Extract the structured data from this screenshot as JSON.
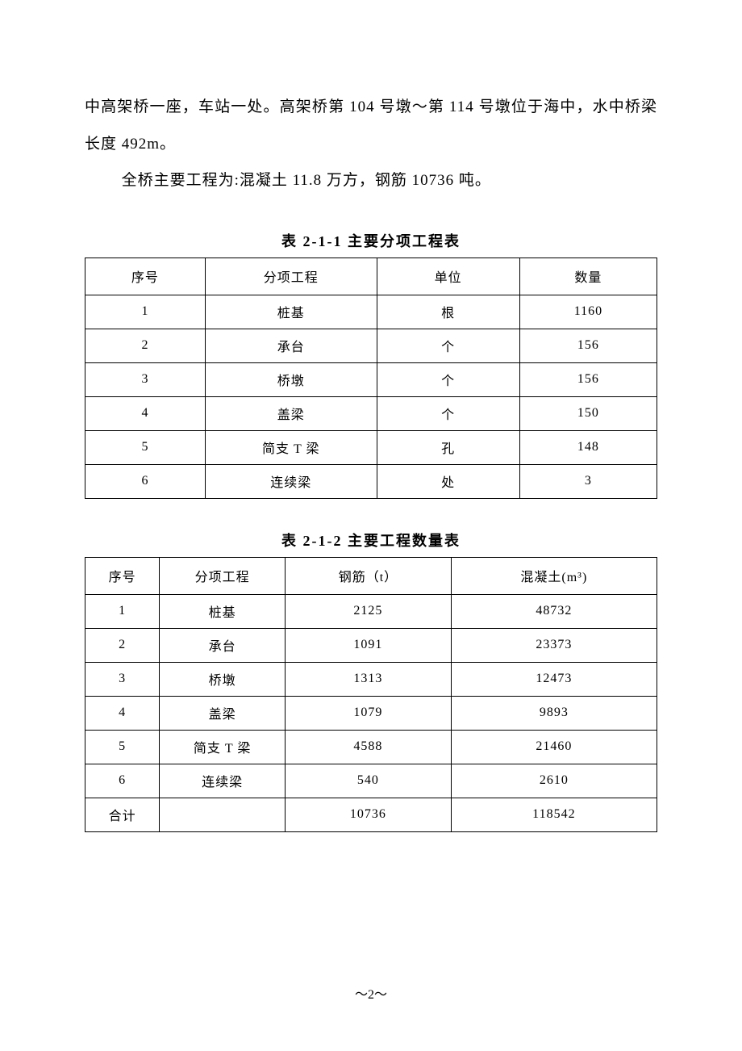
{
  "paragraphs": {
    "p1": "中高架桥一座，车站一处。高架桥第 104 号墩～第 114 号墩位于海中，水中桥梁长度 492m。",
    "p2": "全桥主要工程为:混凝土 11.8 万方，钢筋 10736 吨。"
  },
  "table1": {
    "title": "表 2-1-1   主要分项工程表",
    "headers": [
      "序号",
      "分项工程",
      "单位",
      "数量"
    ],
    "rows": [
      [
        "1",
        "桩基",
        "根",
        "1160"
      ],
      [
        "2",
        "承台",
        "个",
        "156"
      ],
      [
        "3",
        "桥墩",
        "个",
        "156"
      ],
      [
        "4",
        "盖梁",
        "个",
        "150"
      ],
      [
        "5",
        "简支 T 梁",
        "孔",
        "148"
      ],
      [
        "6",
        "连续梁",
        "处",
        "3"
      ]
    ]
  },
  "table2": {
    "title": "表 2-1-2   主要工程数量表",
    "headers": [
      "序号",
      "分项工程",
      "钢筋（t）",
      "混凝土(m³)"
    ],
    "rows": [
      [
        "1",
        "桩基",
        "2125",
        "48732"
      ],
      [
        "2",
        "承台",
        "1091",
        "23373"
      ],
      [
        "3",
        "桥墩",
        "1313",
        "12473"
      ],
      [
        "4",
        "盖梁",
        "1079",
        "9893"
      ],
      [
        "5",
        "简支 T 梁",
        "4588",
        "21460"
      ],
      [
        "6",
        "连续梁",
        "540",
        "2610"
      ],
      [
        "合计",
        "",
        "10736",
        "118542"
      ]
    ]
  },
  "page_number": "～2～"
}
